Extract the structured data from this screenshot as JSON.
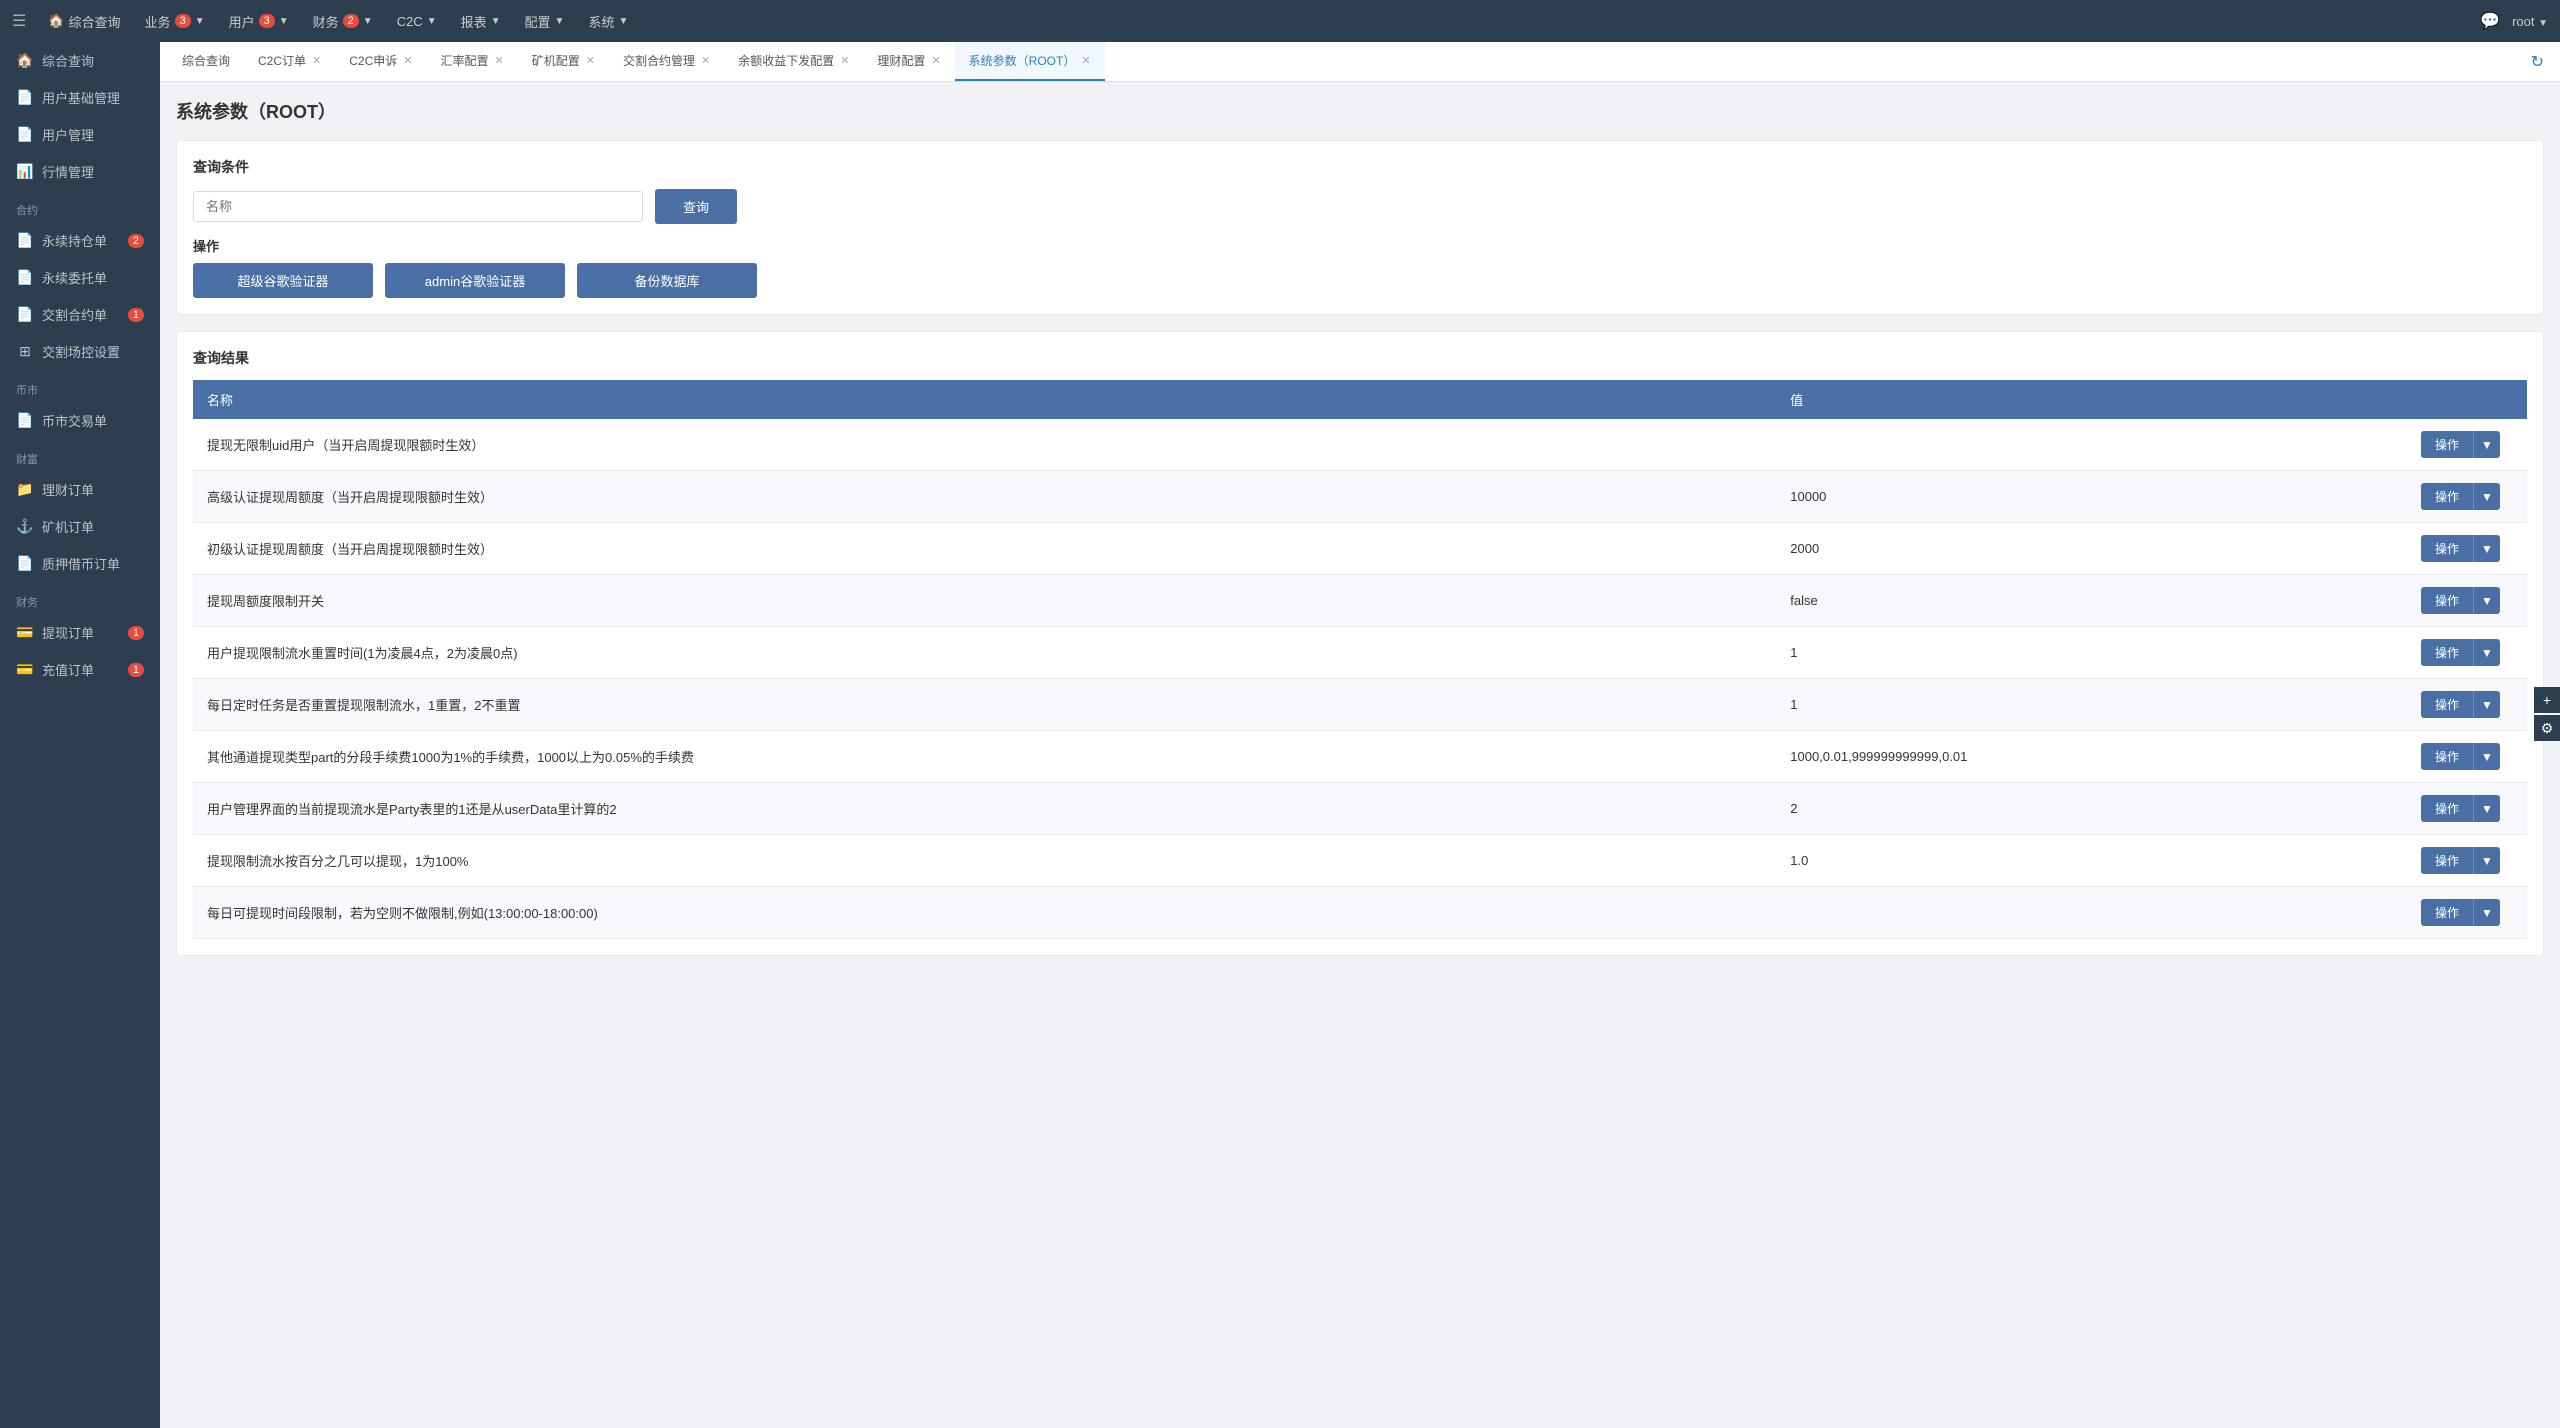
{
  "topNav": {
    "menuIcon": "☰",
    "items": [
      {
        "label": "综合查询",
        "badge": null,
        "icon": "🏠"
      },
      {
        "label": "业务",
        "badge": "3",
        "arrow": "▼"
      },
      {
        "label": "用户",
        "badge": "3",
        "arrow": "▼"
      },
      {
        "label": "财务",
        "badge": "2",
        "arrow": "▼"
      },
      {
        "label": "C2C",
        "badge": null,
        "arrow": "▼"
      },
      {
        "label": "报表",
        "badge": null,
        "arrow": "▼"
      },
      {
        "label": "配置",
        "badge": null,
        "arrow": "▼"
      },
      {
        "label": "系统",
        "badge": null,
        "arrow": "▼"
      }
    ],
    "chatIcon": "💬",
    "userLabel": "root",
    "userArrow": "▼"
  },
  "tabs": [
    {
      "label": "综合查询",
      "closable": false,
      "active": false
    },
    {
      "label": "C2C订单",
      "closable": true,
      "active": false
    },
    {
      "label": "C2C申诉",
      "closable": true,
      "active": false
    },
    {
      "label": "汇率配置",
      "closable": true,
      "active": false
    },
    {
      "label": "矿机配置",
      "closable": true,
      "active": false
    },
    {
      "label": "交割合约管理",
      "closable": true,
      "active": false
    },
    {
      "label": "余额收益下发配置",
      "closable": true,
      "active": false
    },
    {
      "label": "理财配置",
      "closable": true,
      "active": false
    },
    {
      "label": "系统参数（ROOT）",
      "closable": true,
      "active": true
    }
  ],
  "sidebar": {
    "sections": [
      {
        "label": "",
        "items": [
          {
            "icon": "🏠",
            "label": "综合查询",
            "badge": null
          },
          {
            "icon": "📄",
            "label": "用户基础管理",
            "badge": null
          },
          {
            "icon": "📄",
            "label": "用户管理",
            "badge": null
          },
          {
            "icon": "📊",
            "label": "行情管理",
            "badge": null
          }
        ]
      },
      {
        "label": "合约",
        "items": [
          {
            "icon": "📄",
            "label": "永续持仓单",
            "badge": "2"
          },
          {
            "icon": "📄",
            "label": "永续委托单",
            "badge": null
          },
          {
            "icon": "📄",
            "label": "交割合约单",
            "badge": "1"
          },
          {
            "icon": "⊞",
            "label": "交割场控设置",
            "badge": null
          }
        ]
      },
      {
        "label": "币市",
        "items": [
          {
            "icon": "📄",
            "label": "币市交易单",
            "badge": null
          }
        ]
      },
      {
        "label": "财富",
        "items": [
          {
            "icon": "📁",
            "label": "理财订单",
            "badge": null
          },
          {
            "icon": "⚓",
            "label": "矿机订单",
            "badge": null
          },
          {
            "icon": "📄",
            "label": "质押借币订单",
            "badge": null
          }
        ]
      },
      {
        "label": "财务",
        "items": [
          {
            "icon": "💳",
            "label": "提现订单",
            "badge": "1"
          },
          {
            "icon": "💳",
            "label": "充值订单",
            "badge": "1"
          }
        ]
      }
    ]
  },
  "page": {
    "title": "系统参数（ROOT）",
    "queryConditions": "查询条件",
    "namePlaceholder": "名称",
    "queryBtn": "查询",
    "operationsLabel": "操作",
    "btn1": "超级谷歌验证器",
    "btn2": "admin谷歌验证器",
    "btn3": "备份数据库",
    "resultsLabel": "查询结果",
    "tableHeaders": [
      "名称",
      "值"
    ],
    "tableRows": [
      {
        "name": "提现无限制uid用户（当开启周提现限额时生效）",
        "value": ""
      },
      {
        "name": "高级认证提现周额度（当开启周提现限额时生效）",
        "value": "10000"
      },
      {
        "name": "初级认证提现周额度（当开启周提现限额时生效）",
        "value": "2000"
      },
      {
        "name": "提现周额度限制开关",
        "value": "false"
      },
      {
        "name": "用户提现限制流水重置时间(1为凌晨4点，2为凌晨0点)",
        "value": "1"
      },
      {
        "name": "每日定时任务是否重置提现限制流水，1重置，2不重置",
        "value": "1"
      },
      {
        "name": "其他通道提现类型part的分段手续费1000为1%的手续费，1000以上为0.05%的手续费",
        "value": "1000,0.01,999999999999,0.01"
      },
      {
        "name": "用户管理界面的当前提现流水是Party表里的1还是从userData里计算的2",
        "value": "2"
      },
      {
        "name": "提现限制流水按百分之几可以提现，1为100%",
        "value": "1.0"
      },
      {
        "name": "每日可提现时间段限制，若为空则不做限制,例如(13:00:00-18:00:00)",
        "value": ""
      }
    ],
    "actionBtn": "操作",
    "dropdownArrow": "▼"
  }
}
